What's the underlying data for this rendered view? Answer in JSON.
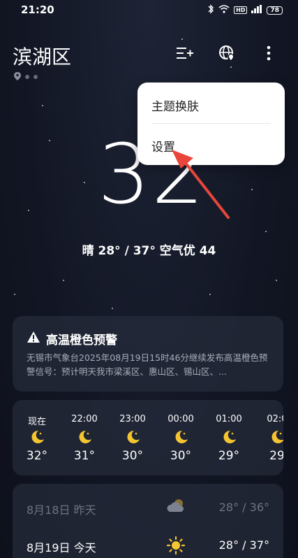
{
  "status_bar": {
    "time": "21:20",
    "hd_label": "HD",
    "battery": "78"
  },
  "location": {
    "city": "滨湖区"
  },
  "current": {
    "temperature": "32",
    "summary": "晴  28° / 37°  空气优 44"
  },
  "menu": {
    "items": [
      {
        "label": "主题换肤"
      },
      {
        "label": "设置"
      }
    ]
  },
  "alert": {
    "title": "高温橙色预警",
    "body": "无锡市气象台2025年08月19日15时46分继续发布高温橙色预警信号：预计明天我市梁溪区、惠山区、锡山区、..."
  },
  "hourly": [
    {
      "time": "现在",
      "temp": "32°",
      "icon": "moon-cloud-icon"
    },
    {
      "time": "22:00",
      "temp": "31°",
      "icon": "moon-cloud-icon"
    },
    {
      "time": "23:00",
      "temp": "30°",
      "icon": "moon-cloud-icon"
    },
    {
      "time": "00:00",
      "temp": "30°",
      "icon": "moon-cloud-icon"
    },
    {
      "time": "01:00",
      "temp": "29°",
      "icon": "moon-cloud-icon"
    },
    {
      "time": "02:0",
      "temp": "29",
      "icon": "moon-cloud-icon"
    }
  ],
  "daily": [
    {
      "date": "8月18日  昨天",
      "range": "28° / 36°",
      "icon": "cloud-icon"
    },
    {
      "date": "8月19日  今天",
      "range": "28° / 37°",
      "icon": "sun-icon"
    }
  ],
  "colors": {
    "background": "#121624",
    "card": "#282e3e",
    "sun": "#f5c531",
    "arrow": "#e8463a"
  }
}
